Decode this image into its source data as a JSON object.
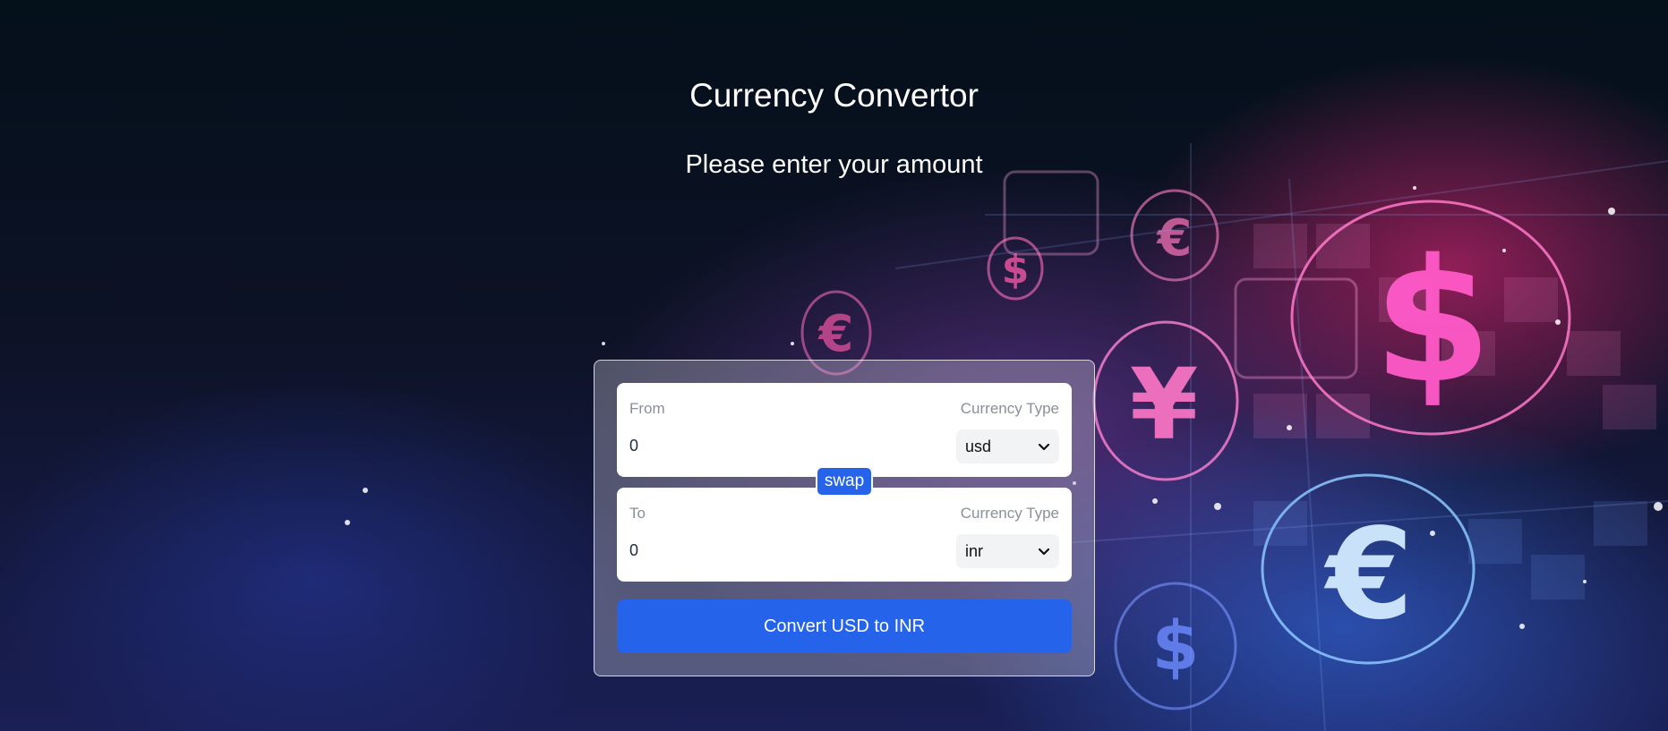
{
  "header": {
    "title": "Currency Convertor",
    "subtitle": "Please enter your amount"
  },
  "from": {
    "label": "From",
    "currency_label": "Currency Type",
    "amount": "0",
    "currency": "usd"
  },
  "to": {
    "label": "To",
    "currency_label": "Currency Type",
    "amount": "0",
    "currency": "inr"
  },
  "swap_label": "swap",
  "convert_label": "Convert USD to INR",
  "background_icons": [
    "dollar-icon",
    "euro-icon",
    "yen-icon"
  ],
  "colors": {
    "accent": "#2563eb",
    "background_dark": "#04101a",
    "glow_pink": "#ff2882",
    "glow_blue": "#3c78ff"
  }
}
